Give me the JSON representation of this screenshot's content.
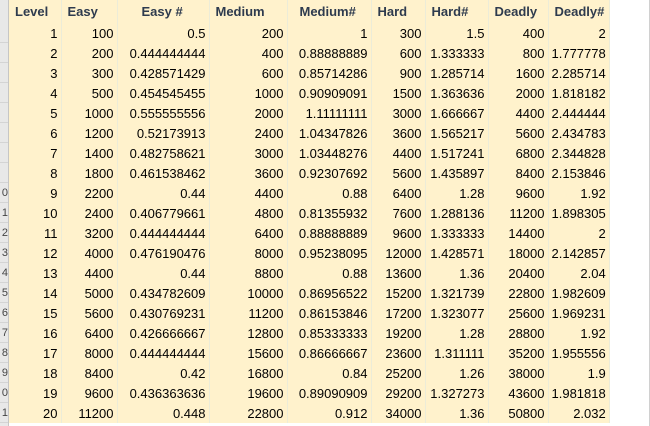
{
  "sheet": {
    "headers": [
      "Level",
      "Easy",
      "Easy #",
      "Medium",
      "Medium#",
      "Hard",
      "Hard#",
      "Deadly",
      "Deadly#"
    ],
    "row_numbers": [
      "",
      "",
      "",
      "",
      "",
      "",
      "",
      "",
      "0",
      "1",
      "2",
      "3",
      "4",
      "5",
      "6",
      "7",
      "8",
      "9",
      "0",
      "1"
    ],
    "rows": [
      [
        "1",
        "100",
        "0.5",
        "200",
        "1",
        "300",
        "1.5",
        "400",
        "2"
      ],
      [
        "2",
        "200",
        "0.444444444",
        "400",
        "0.88888889",
        "600",
        "1.333333",
        "800",
        "1.777778"
      ],
      [
        "3",
        "300",
        "0.428571429",
        "600",
        "0.85714286",
        "900",
        "1.285714",
        "1600",
        "2.285714"
      ],
      [
        "4",
        "500",
        "0.454545455",
        "1000",
        "0.90909091",
        "1500",
        "1.363636",
        "2000",
        "1.818182"
      ],
      [
        "5",
        "1000",
        "0.555555556",
        "2000",
        "1.11111111",
        "3000",
        "1.666667",
        "4400",
        "2.444444"
      ],
      [
        "6",
        "1200",
        "0.52173913",
        "2400",
        "1.04347826",
        "3600",
        "1.565217",
        "5600",
        "2.434783"
      ],
      [
        "7",
        "1400",
        "0.482758621",
        "3000",
        "1.03448276",
        "4400",
        "1.517241",
        "6800",
        "2.344828"
      ],
      [
        "8",
        "1800",
        "0.461538462",
        "3600",
        "0.92307692",
        "5600",
        "1.435897",
        "8400",
        "2.153846"
      ],
      [
        "9",
        "2200",
        "0.44",
        "4400",
        "0.88",
        "6400",
        "1.28",
        "9600",
        "1.92"
      ],
      [
        "10",
        "2400",
        "0.406779661",
        "4800",
        "0.81355932",
        "7600",
        "1.288136",
        "11200",
        "1.898305"
      ],
      [
        "11",
        "3200",
        "0.444444444",
        "6400",
        "0.88888889",
        "9600",
        "1.333333",
        "14400",
        "2"
      ],
      [
        "12",
        "4000",
        "0.476190476",
        "8000",
        "0.95238095",
        "12000",
        "1.428571",
        "18000",
        "2.142857"
      ],
      [
        "13",
        "4400",
        "0.44",
        "8800",
        "0.88",
        "13600",
        "1.36",
        "20400",
        "2.04"
      ],
      [
        "14",
        "5000",
        "0.434782609",
        "10000",
        "0.86956522",
        "15200",
        "1.321739",
        "22800",
        "1.982609"
      ],
      [
        "15",
        "5600",
        "0.430769231",
        "11200",
        "0.86153846",
        "17200",
        "1.323077",
        "25600",
        "1.969231"
      ],
      [
        "16",
        "6400",
        "0.426666667",
        "12800",
        "0.85333333",
        "19200",
        "1.28",
        "28800",
        "1.92"
      ],
      [
        "17",
        "8000",
        "0.444444444",
        "15600",
        "0.86666667",
        "23600",
        "1.311111",
        "35200",
        "1.955556"
      ],
      [
        "18",
        "8400",
        "0.42",
        "16800",
        "0.84",
        "25200",
        "1.26",
        "38000",
        "1.9"
      ],
      [
        "19",
        "9600",
        "0.436363636",
        "19600",
        "0.89090909",
        "29200",
        "1.327273",
        "43600",
        "1.981818"
      ],
      [
        "20",
        "11200",
        "0.448",
        "22800",
        "0.912",
        "34000",
        "1.36",
        "50800",
        "2.032"
      ]
    ],
    "cell_fill": "#fff2cc",
    "header_text_color": "#2e3b4e"
  }
}
